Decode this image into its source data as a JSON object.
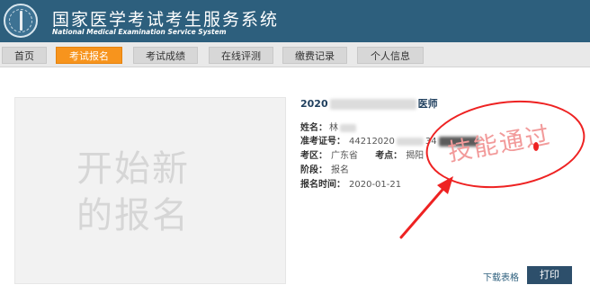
{
  "header": {
    "title": "国家医学考试考生服务系统",
    "subtitle": "National Medical Examination Service System"
  },
  "nav": {
    "tabs": [
      {
        "label": "首页",
        "active": false
      },
      {
        "label": "考试报名",
        "active": true
      },
      {
        "label": "考试成绩",
        "active": false
      },
      {
        "label": "在线评测",
        "active": false
      },
      {
        "label": "缴费记录",
        "active": false
      },
      {
        "label": "个人信息",
        "active": false
      }
    ]
  },
  "new_registration": {
    "label": "开始新的报名"
  },
  "record": {
    "title_prefix": "2020",
    "title_suffix": "医师",
    "name_label": "姓名：",
    "name_value": "林",
    "ticket_label": "准考证号：",
    "ticket_value": "44212020",
    "ticket_tail": "34",
    "region_label": "考区：",
    "region_value": "广东省",
    "site_label": "考点：",
    "site_value": "揭阳",
    "stage_label": "阶段：",
    "stage_value": "报名",
    "time_label": "报名时间：",
    "time_value": "2020-01-21"
  },
  "annotation": {
    "stamp_text": "技能通过",
    "colors": {
      "stamp": "#ee2222"
    }
  },
  "actions": {
    "download_label": "下载表格",
    "print_label": "打印"
  },
  "colors": {
    "header_bg": "#2d5f7d",
    "active_tab": "#f7941d",
    "print_button": "#2d4f6b"
  }
}
